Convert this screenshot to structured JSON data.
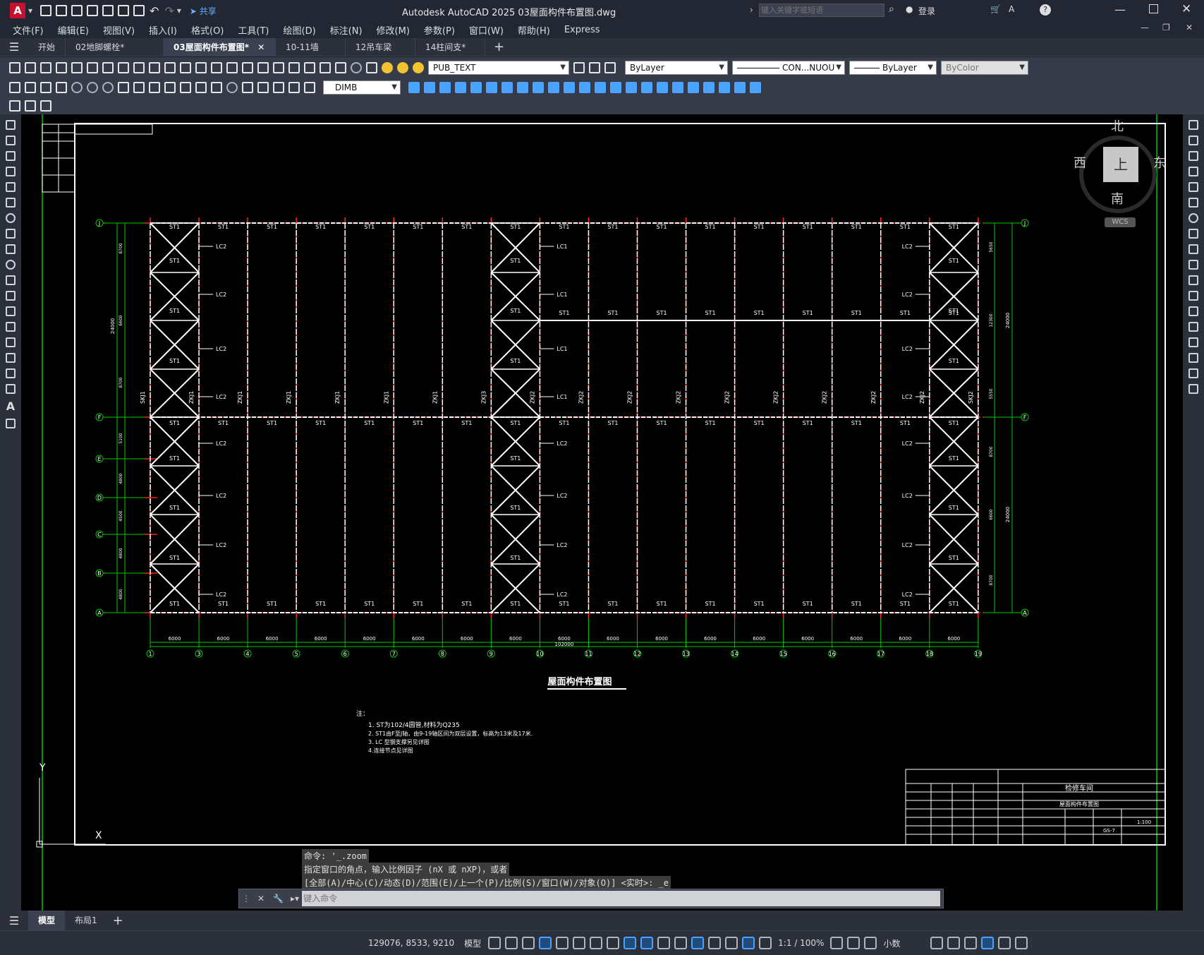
{
  "app": {
    "title": "Autodesk AutoCAD 2025    03屋面构件布置图.dwg",
    "share": "共享",
    "search_placeholder": "键入关键字或短语",
    "login": "登录"
  },
  "menu": [
    "文件(F)",
    "编辑(E)",
    "视图(V)",
    "插入(I)",
    "格式(O)",
    "工具(T)",
    "绘图(D)",
    "标注(N)",
    "修改(M)",
    "参数(P)",
    "窗口(W)",
    "帮助(H)",
    "Express"
  ],
  "tabs": [
    {
      "label": "开始",
      "active": false
    },
    {
      "label": "02地脚螺栓*",
      "active": false
    },
    {
      "label": "03屋面构件布置图*",
      "active": true
    },
    {
      "label": "10-11墙",
      "active": false
    },
    {
      "label": "12吊车梁",
      "active": false
    },
    {
      "label": "14柱间支*",
      "active": false
    }
  ],
  "toolbar": {
    "layer": "PUB_TEXT",
    "color": "ByLayer",
    "linetype": "CON...NUOU",
    "lineweight": "ByLayer",
    "plotstyle": "ByColor",
    "dimstyle": "DIMB"
  },
  "viewcube": {
    "north": "北",
    "south": "南",
    "east": "东",
    "west": "西",
    "top": "上",
    "wcs": "WCS"
  },
  "drawing": {
    "title": "屋面构件布置图",
    "notes_label": "注：",
    "notes": [
      "1. ST为102/4圆管,材料为Q235",
      "2. ST1由F至J轴，由9-19轴区间为双层设置，标高为13米及17米.",
      "3. LC 型钢支撑另见详图",
      "4.连接节点见详图"
    ],
    "col_labels": [
      "1",
      "3",
      "4",
      "5",
      "6",
      "7",
      "8",
      "9",
      "10",
      "11",
      "12",
      "13",
      "14",
      "15",
      "16",
      "17",
      "18",
      "19"
    ],
    "row_labels": [
      "J",
      "F",
      "E",
      "D",
      "C",
      "B",
      "A"
    ],
    "bay_dim": "6000",
    "total_dim": "102000",
    "left_dims": [
      "8700",
      "6600",
      "8700",
      "5100",
      "4800",
      "4500",
      "4800",
      "4800"
    ],
    "left_total": "24000",
    "right_dims": [
      "5650",
      "12300",
      "5550",
      "8700",
      "6600",
      "8700"
    ],
    "right_total": "24000",
    "member_st": "ST1",
    "member_lc1": "LC1",
    "member_lc2": "LC2",
    "truss_labels": [
      "SKJ1",
      "ZKJ1",
      "ZKJ1",
      "ZKJ1",
      "ZKJ1",
      "ZKJ1",
      "ZKJ1",
      "ZKJ3",
      "ZKJ2",
      "ZKJ2",
      "ZKJ2",
      "ZKJ2",
      "ZKJ2",
      "ZKJ2",
      "ZKJ2",
      "ZKJ2",
      "ZKJ2",
      "SKJ2"
    ],
    "titleblock": {
      "project": "检修车间",
      "drawing": "屋面构件布置图",
      "no": "GS-7",
      "scale": "1:100"
    }
  },
  "command": {
    "history": [
      "命令: '_.zoom",
      "指定窗口的角点，输入比例因子 (nX 或 nXP)，或者",
      "[全部(A)/中心(C)/动态(D)/范围(E)/上一个(P)/比例(S)/窗口(W)/对象(O)] <实时>: _e"
    ],
    "placeholder": "键入命令"
  },
  "layout_tabs": [
    "模型",
    "布局1"
  ],
  "status": {
    "coords": "129076, 8533, 9210",
    "model": "模型",
    "scale": "1:1 / 100%",
    "units": "小数"
  },
  "colors": {
    "accent": "#4aa3ff",
    "grid_green": "#00c800",
    "axis_red": "#ff2020",
    "member_white": "#ffffff"
  }
}
